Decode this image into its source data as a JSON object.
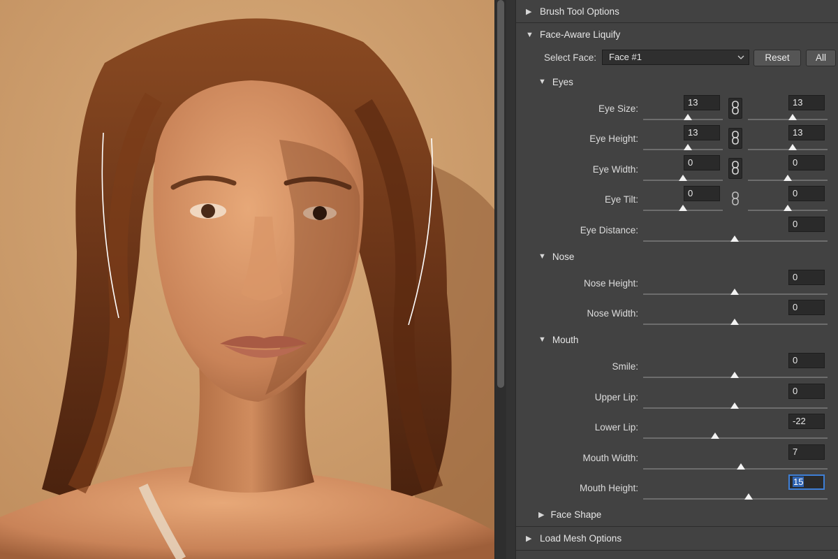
{
  "sections": {
    "brush_tool_options": "Brush Tool Options",
    "face_aware_liquify": "Face-Aware Liquify",
    "load_mesh_options": "Load Mesh Options"
  },
  "face_select": {
    "label": "Select Face:",
    "value": "Face #1",
    "reset_label": "Reset",
    "all_label": "All"
  },
  "eyes": {
    "title": "Eyes",
    "eye_size": {
      "label": "Eye Size:",
      "left": "13",
      "right": "13"
    },
    "eye_height": {
      "label": "Eye Height:",
      "left": "13",
      "right": "13"
    },
    "eye_width": {
      "label": "Eye Width:",
      "left": "0",
      "right": "0"
    },
    "eye_tilt": {
      "label": "Eye Tilt:",
      "left": "0",
      "right": "0"
    },
    "eye_distance": {
      "label": "Eye Distance:",
      "value": "0"
    }
  },
  "nose": {
    "title": "Nose",
    "nose_height": {
      "label": "Nose Height:",
      "value": "0"
    },
    "nose_width": {
      "label": "Nose Width:",
      "value": "0"
    }
  },
  "mouth": {
    "title": "Mouth",
    "smile": {
      "label": "Smile:",
      "value": "0"
    },
    "upper_lip": {
      "label": "Upper Lip:",
      "value": "0"
    },
    "lower_lip": {
      "label": "Lower Lip:",
      "value": "-22"
    },
    "mouth_width": {
      "label": "Mouth Width:",
      "value": "7"
    },
    "mouth_height": {
      "label": "Mouth Height:",
      "value": "15"
    }
  },
  "face_shape": {
    "title": "Face Shape"
  },
  "icons": {
    "collapsed": "triangle-right-icon",
    "expanded": "triangle-down-icon",
    "link": "chain-link-icon",
    "dropdown": "chevron-down-icon"
  }
}
